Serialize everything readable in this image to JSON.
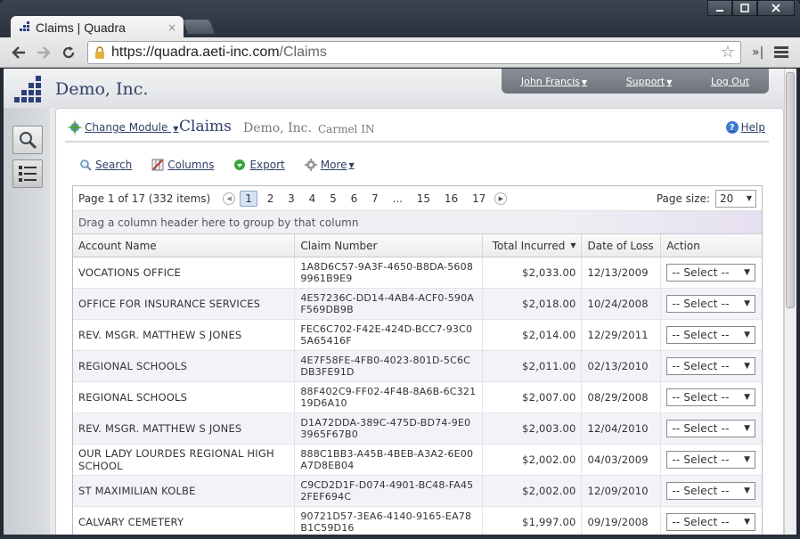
{
  "browser": {
    "tab_title": "Claims | Quadra",
    "tab_close": "×",
    "url_host": "https://quadra.aeti-inc.com",
    "url_path": "/Claims"
  },
  "header": {
    "company": "Demo, Inc.",
    "user_menu": "John Francis",
    "support_menu": "Support",
    "logout": "Log Out"
  },
  "titlebar": {
    "change_module": "Change Module",
    "title": "Claims",
    "org": "Demo, Inc.",
    "location": "Carmel IN",
    "help": "Help"
  },
  "actions": {
    "search": "Search",
    "columns": "Columns",
    "export": "Export",
    "more": "More"
  },
  "pager": {
    "info": "Page 1 of 17 (332 items)",
    "pages": [
      "1",
      "2",
      "3",
      "4",
      "5",
      "6",
      "7",
      "...",
      "15",
      "16",
      "17"
    ],
    "current": "1",
    "page_size_label": "Page size:",
    "page_size": "20"
  },
  "group_panel": "Drag a column header here to group by that column",
  "columns": [
    "Account Name",
    "Claim Number",
    "Total Incurred",
    "Date of Loss",
    "Action"
  ],
  "select_label": "-- Select --",
  "rows": [
    {
      "account": "VOCATIONS OFFICE",
      "claim": "1A8D6C57-9A3F-4650-B8DA-56089961B9E9",
      "total": "$2,033.00",
      "date": "12/13/2009"
    },
    {
      "account": "OFFICE FOR INSURANCE SERVICES",
      "claim": "4E57236C-DD14-4AB4-ACF0-590AF569DB9B",
      "total": "$2,018.00",
      "date": "10/24/2008"
    },
    {
      "account": "REV. MSGR. MATTHEW S JONES",
      "claim": "FEC6C702-F42E-424D-BCC7-93C05A65416F",
      "total": "$2,014.00",
      "date": "12/29/2011"
    },
    {
      "account": "REGIONAL SCHOOLS",
      "claim": "4E7F58FE-4FB0-4023-801D-5C6CDB3FE91D",
      "total": "$2,011.00",
      "date": "02/13/2010"
    },
    {
      "account": "REGIONAL SCHOOLS",
      "claim": "88F402C9-FF02-4F4B-8A6B-6C32119D6A10",
      "total": "$2,007.00",
      "date": "08/29/2008"
    },
    {
      "account": "REV. MSGR. MATTHEW S JONES",
      "claim": "D1A72DDA-389C-475D-BD74-9E03965F67B0",
      "total": "$2,003.00",
      "date": "12/04/2010"
    },
    {
      "account": "OUR LADY LOURDES REGIONAL HIGH SCHOOL",
      "claim": "888C1BB3-A45B-4BEB-A3A2-6E00A7D8EB04",
      "total": "$2,002.00",
      "date": "04/03/2009"
    },
    {
      "account": "ST MAXIMILIAN KOLBE",
      "claim": "C9CD2D1F-D074-4901-BC48-FA452FEF694C",
      "total": "$2,002.00",
      "date": "12/09/2010"
    },
    {
      "account": "CALVARY CEMETERY",
      "claim": "90721D57-3EA6-4140-9165-EA78B1C59D16",
      "total": "$1,997.00",
      "date": "09/19/2008"
    }
  ],
  "icons": {
    "search": "magnifier-icon",
    "columns": "columns-icon",
    "export": "export-icon",
    "more": "gear-icon"
  },
  "colors": {
    "brand": "#2f3f68",
    "link": "#2f3f68"
  }
}
